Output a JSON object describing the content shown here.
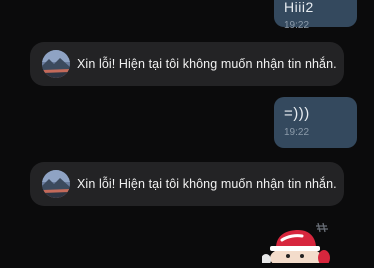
{
  "messages": [
    {
      "direction": "outgoing",
      "text": "Hiii2",
      "time": "19:22"
    },
    {
      "direction": "incoming",
      "text": "Xin lỗi! Hiện tại tôi không muốn nhận tin nhắn."
    },
    {
      "direction": "outgoing",
      "text": "=)))",
      "time": "19:22"
    },
    {
      "direction": "incoming",
      "text": "Xin lỗi! Hiện tại tôi không muốn nhận tin nhắn."
    }
  ],
  "sticker": {
    "icon": "cartoon-sticker-icon"
  },
  "colors": {
    "background": "#0b0b0c",
    "outgoing_bubble": "#34495e",
    "incoming_bubble": "#232325",
    "timestamp": "#8c9baa"
  }
}
